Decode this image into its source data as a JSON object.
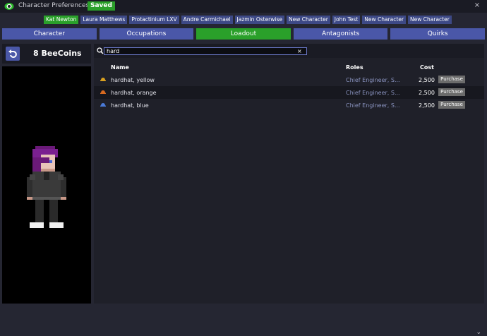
{
  "window": {
    "title": "Character Preferences",
    "saved_badge": "Saved",
    "close": "×"
  },
  "characters": [
    {
      "name": "Kat Newton",
      "active": true
    },
    {
      "name": "Laura Matthews"
    },
    {
      "name": "Protactinium LXV"
    },
    {
      "name": "Andre Carmichael"
    },
    {
      "name": "Jazmin Osterwise"
    },
    {
      "name": "New Character"
    },
    {
      "name": "John Test"
    },
    {
      "name": "New Character"
    },
    {
      "name": "New Character"
    }
  ],
  "tabs": [
    {
      "label": "Character"
    },
    {
      "label": "Occupations"
    },
    {
      "label": "Loadout",
      "active": true
    },
    {
      "label": "Antagonists"
    },
    {
      "label": "Quirks"
    }
  ],
  "balance": {
    "label": "8 BeeCoins"
  },
  "search": {
    "value": "hard",
    "clear": "×"
  },
  "table": {
    "headers": {
      "name": "Name",
      "roles": "Roles",
      "cost": "Cost"
    },
    "rows": [
      {
        "name": "hardhat, yellow",
        "roles": "Chief Engineer, S...",
        "cost": "2,500",
        "action": "Purchase",
        "icon_color": "#d8a020"
      },
      {
        "name": "hardhat, orange",
        "roles": "Chief Engineer, S...",
        "cost": "2,500",
        "action": "Purchase",
        "icon_color": "#d86a20"
      },
      {
        "name": "hardhat, blue",
        "roles": "Chief Engineer, S...",
        "cost": "2,500",
        "action": "Purchase",
        "icon_color": "#4a7ad8"
      }
    ]
  },
  "colors": {
    "accent": "#4a57a8",
    "active": "#2aa02a"
  }
}
